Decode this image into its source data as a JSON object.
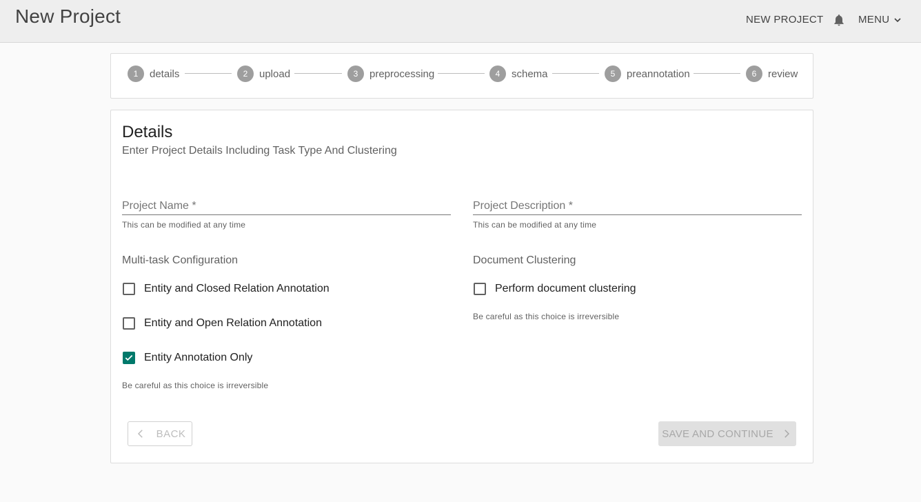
{
  "header": {
    "title": "New Project",
    "new_project_label": "NEW PROJECT",
    "menu_label": "MENU"
  },
  "stepper": {
    "steps": [
      {
        "number": "1",
        "label": "details"
      },
      {
        "number": "2",
        "label": "upload"
      },
      {
        "number": "3",
        "label": "preprocessing"
      },
      {
        "number": "4",
        "label": "schema"
      },
      {
        "number": "5",
        "label": "preannotation"
      },
      {
        "number": "6",
        "label": "review"
      }
    ]
  },
  "details": {
    "title": "Details",
    "subtitle": "Enter Project Details Including Task Type And Clustering",
    "project_name": {
      "placeholder": "Project Name *",
      "value": "",
      "hint": "This can be modified at any time"
    },
    "project_description": {
      "placeholder": "Project Description *",
      "value": "",
      "hint": "This can be modified at any time"
    },
    "multitask": {
      "label": "Multi-task Configuration",
      "options": [
        {
          "label": "Entity and Closed Relation Annotation",
          "checked": false
        },
        {
          "label": "Entity and Open Relation Annotation",
          "checked": false
        },
        {
          "label": "Entity Annotation Only",
          "checked": true
        }
      ],
      "warning": "Be careful as this choice is irreversible"
    },
    "clustering": {
      "label": "Document Clustering",
      "option": {
        "label": "Perform document clustering",
        "checked": false
      },
      "warning": "Be careful as this choice is irreversible"
    }
  },
  "actions": {
    "back_label": "BACK",
    "save_label": "SAVE AND CONTINUE"
  },
  "colors": {
    "accent": "#00796b",
    "step_circle": "#9e9e9e",
    "appbar": "#eeeeee"
  }
}
